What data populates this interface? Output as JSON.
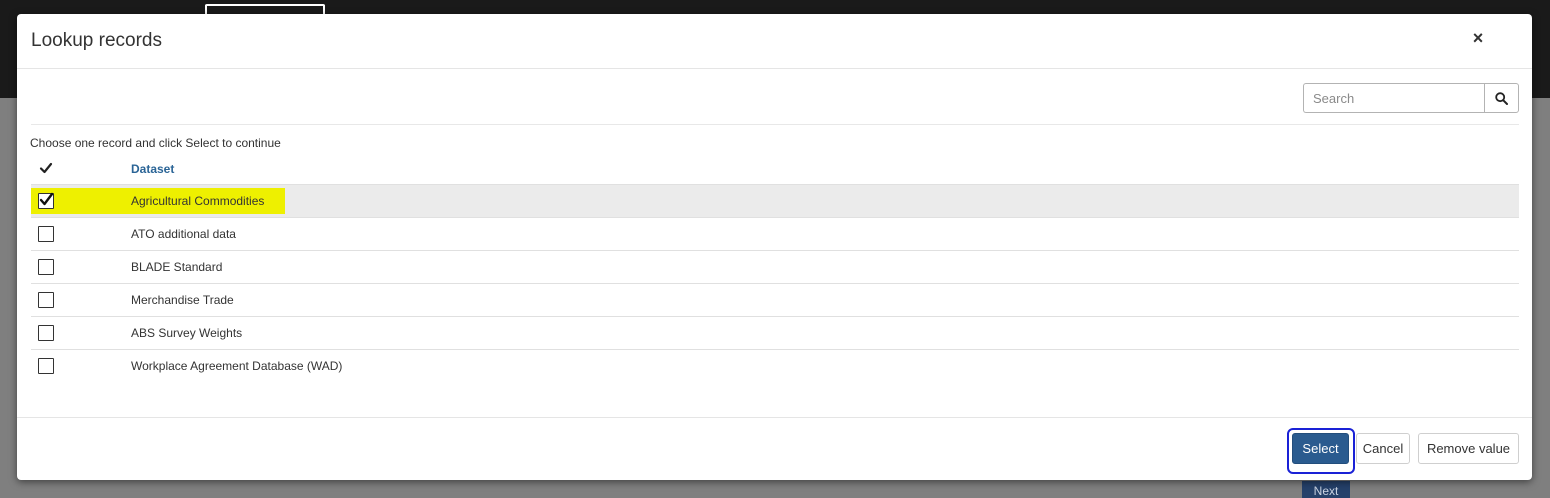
{
  "background": {
    "next_label": "Next"
  },
  "modal": {
    "title": "Lookup records",
    "close_glyph": "×",
    "search": {
      "placeholder": "Search",
      "value": ""
    },
    "instruction": "Choose one record and click Select to continue",
    "grid": {
      "column_header": "Dataset",
      "rows": [
        {
          "label": "Agricultural Commodities",
          "checked": true
        },
        {
          "label": "ATO additional data",
          "checked": false
        },
        {
          "label": "BLADE Standard",
          "checked": false
        },
        {
          "label": "Merchandise Trade",
          "checked": false
        },
        {
          "label": "ABS Survey Weights",
          "checked": false
        },
        {
          "label": "Workplace Agreement Database (WAD)",
          "checked": false
        }
      ]
    },
    "footer": {
      "select_label": "Select",
      "cancel_label": "Cancel",
      "remove_label": "Remove value"
    }
  },
  "colors": {
    "primary_button": "#2a5b8f",
    "focus_ring": "#1a21d6",
    "row_highlight": "#eef000",
    "selected_row": "#ebebeb",
    "column_header": "#2a6496"
  },
  "icons": {
    "close": "close-icon",
    "search": "search-icon",
    "header_check": "checkmark-icon",
    "row_check": "checkbox-checked-icon"
  }
}
